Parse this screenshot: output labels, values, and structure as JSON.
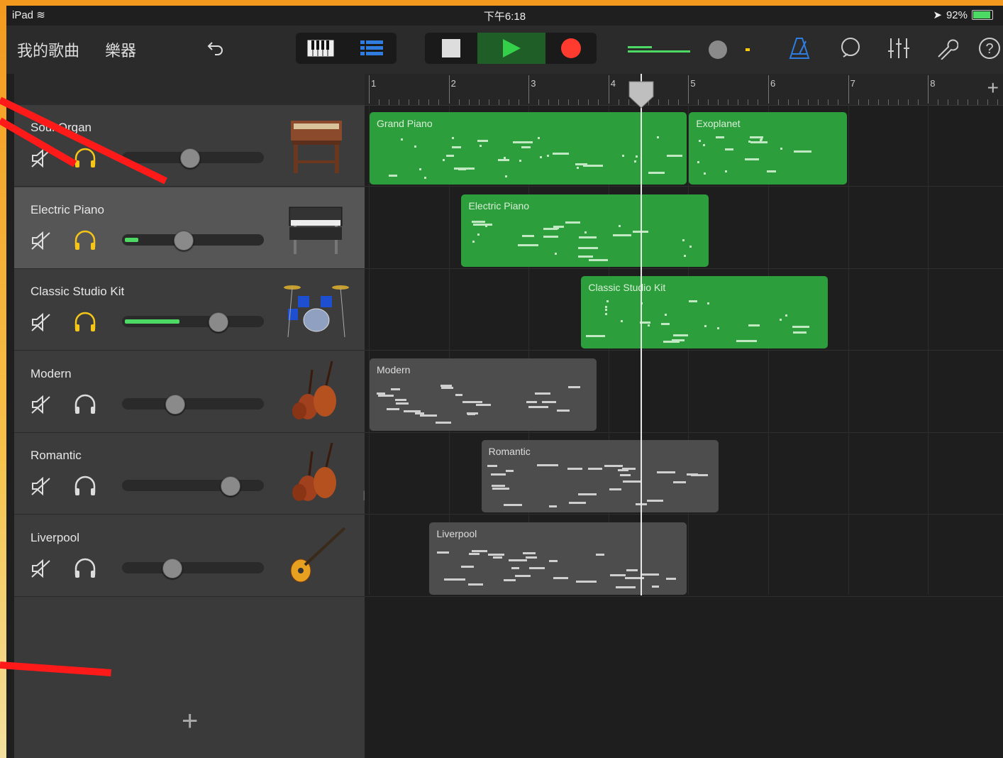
{
  "status": {
    "device": "iPad",
    "time": "下午6:18",
    "battery": "92%",
    "battery_level": 0.92
  },
  "toolbar": {
    "my_songs": "我的歌曲",
    "instruments": "樂器"
  },
  "tracks": [
    {
      "name": "Soul Organ",
      "volume": 0.47,
      "meter": 0.0,
      "solo_active": true,
      "selected": false,
      "instrument": "organ-icon"
    },
    {
      "name": "Electric Piano",
      "volume": 0.42,
      "meter": 0.1,
      "solo_active": true,
      "selected": true,
      "instrument": "electric-piano-icon"
    },
    {
      "name": "Classic Studio Kit",
      "volume": 0.7,
      "meter": 0.4,
      "solo_active": true,
      "selected": false,
      "instrument": "drum-kit-icon"
    },
    {
      "name": "Modern",
      "volume": 0.35,
      "meter": 0.0,
      "solo_active": false,
      "selected": false,
      "instrument": "strings-icon"
    },
    {
      "name": "Romantic",
      "volume": 0.8,
      "meter": 0.0,
      "solo_active": false,
      "selected": false,
      "instrument": "strings-icon"
    },
    {
      "name": "Liverpool",
      "volume": 0.33,
      "meter": 0.0,
      "solo_active": false,
      "selected": false,
      "instrument": "bass-guitar-icon"
    }
  ],
  "ruler": {
    "bars": [
      "1",
      "2",
      "3",
      "4",
      "5",
      "6",
      "7",
      "8"
    ]
  },
  "regions": [
    {
      "lane": 0,
      "name": "Grand Piano",
      "start_bar": 1.0,
      "end_bar": 5.0,
      "color": "#2d9e3c"
    },
    {
      "lane": 0,
      "name": "Exoplanet",
      "start_bar": 5.0,
      "end_bar": 7.0,
      "color": "#2d9e3c"
    },
    {
      "lane": 1,
      "name": "Electric Piano",
      "start_bar": 2.15,
      "end_bar": 5.27,
      "color": "#2d9e3c"
    },
    {
      "lane": 2,
      "name": "Classic Studio Kit",
      "start_bar": 3.65,
      "end_bar": 6.76,
      "color": "#2d9e3c"
    },
    {
      "lane": 3,
      "name": "Modern",
      "start_bar": 1.0,
      "end_bar": 3.87,
      "color": "#4d4d4d"
    },
    {
      "lane": 4,
      "name": "Romantic",
      "start_bar": 2.4,
      "end_bar": 5.4,
      "color": "#4d4d4d"
    },
    {
      "lane": 5,
      "name": "Liverpool",
      "start_bar": 1.75,
      "end_bar": 5.0,
      "color": "#4d4d4d"
    }
  ],
  "playhead_bar": 4.4
}
